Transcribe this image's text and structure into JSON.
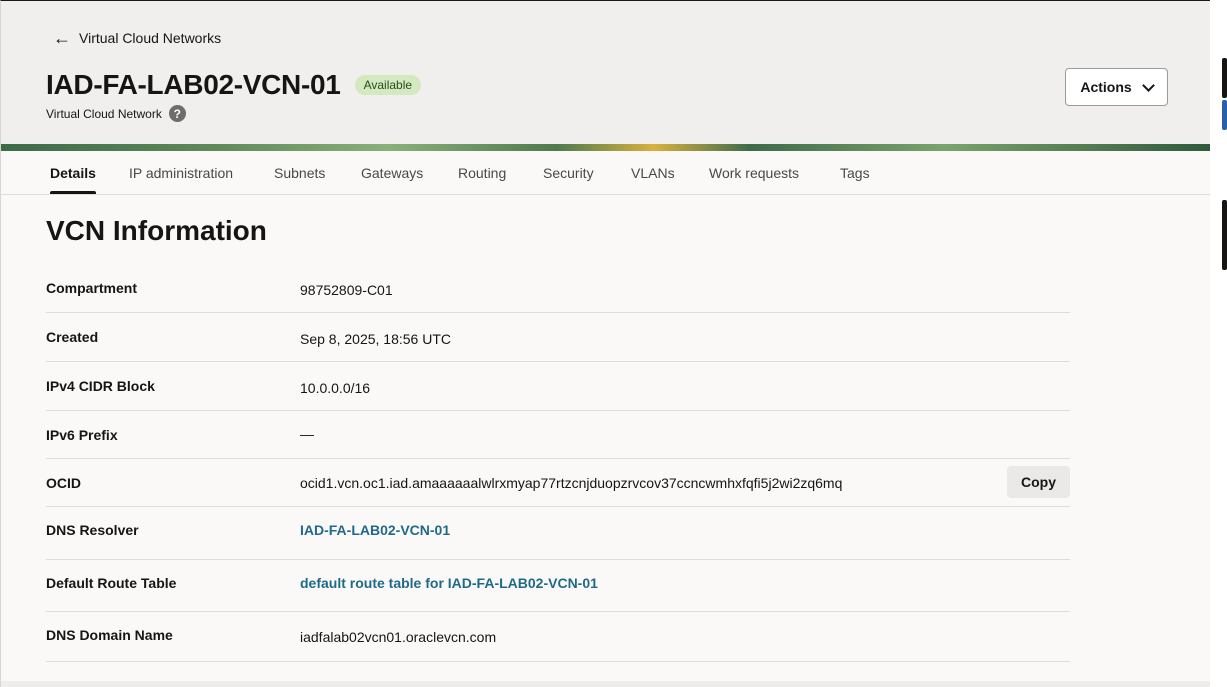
{
  "header": {
    "back_label": "Virtual Cloud Networks",
    "back_icon": "arrow-left-icon",
    "title": "IAD-FA-LAB02-VCN-01",
    "status": "Available",
    "status_color": "#d3eac1",
    "subtitle": "Virtual Cloud Network",
    "help_glyph": "?",
    "actions_label": "Actions"
  },
  "tabs": [
    {
      "label": "Details",
      "active": true
    },
    {
      "label": "IP administration"
    },
    {
      "label": "Subnets"
    },
    {
      "label": "Gateways"
    },
    {
      "label": "Routing"
    },
    {
      "label": "Security"
    },
    {
      "label": "VLANs"
    },
    {
      "label": "Work requests"
    },
    {
      "label": "Tags"
    }
  ],
  "section": {
    "title": "VCN Information",
    "rows": [
      {
        "label": "Compartment",
        "value": "98752809-C01"
      },
      {
        "label": "Created",
        "value": "Sep 8, 2025, 18:56 UTC"
      },
      {
        "label": "IPv4 CIDR Block",
        "value": "10.0.0.0/16"
      },
      {
        "label": "IPv6 Prefix",
        "value": "—"
      },
      {
        "label": "OCID",
        "value": "ocid1.vcn.oc1.iad.amaaaaaalwlrxmyap77rtzcnjduopzrvcov37ccncwmhxfqfi5j2wi2zq6mq",
        "copy_label": "Copy"
      },
      {
        "label": "DNS Resolver",
        "value": "IAD-FA-LAB02-VCN-01",
        "link": true
      },
      {
        "label": "Default Route Table",
        "value": "default route table for IAD-FA-LAB02-VCN-01",
        "link": true
      },
      {
        "label": "DNS Domain Name",
        "value": "iadfalab02vcn01.oraclevcn.com"
      }
    ]
  },
  "colors": {
    "accent_link": "#1f6a8a",
    "header_bg": "#f1efed"
  }
}
